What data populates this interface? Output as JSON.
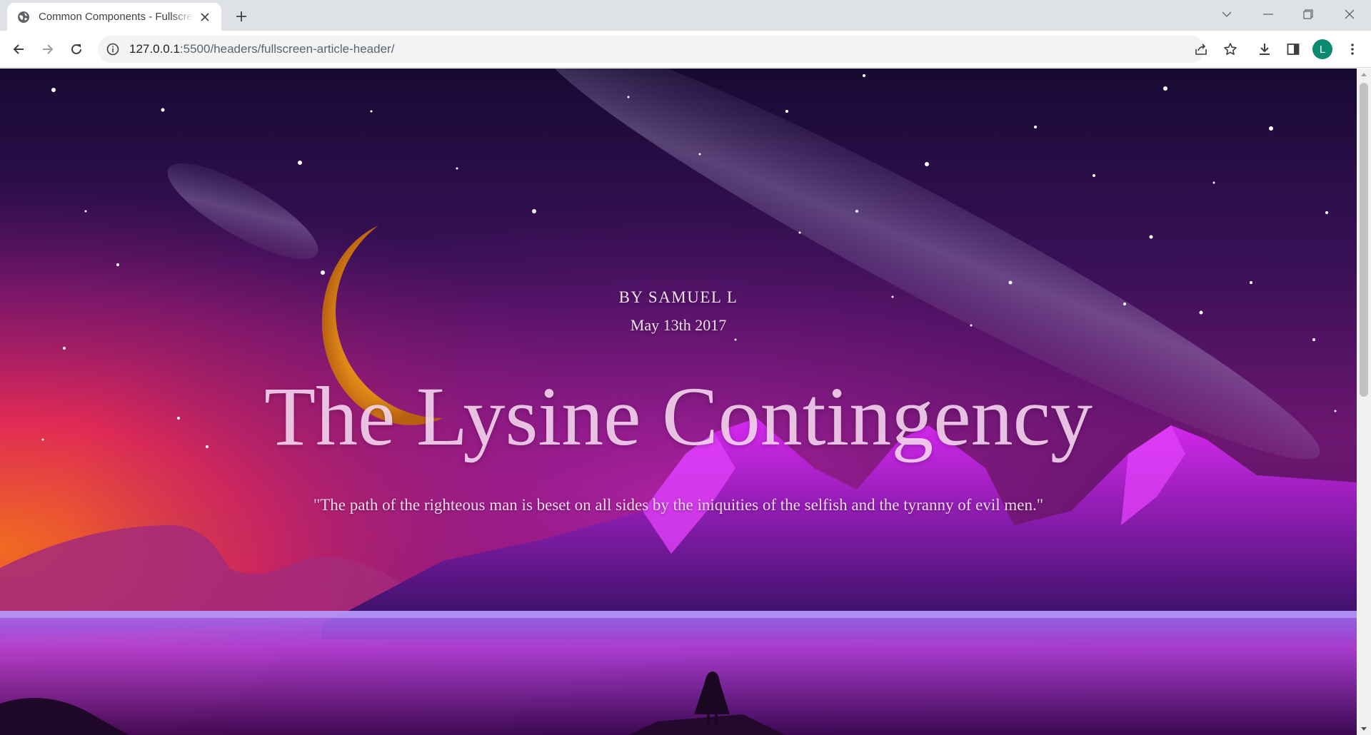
{
  "browser": {
    "tab_title": "Common Components - Fullscreen Article Header",
    "url_host": "127.0.0.1",
    "url_path": ":5500/headers/fullscreen-article-header/",
    "profile_initial": "L",
    "icons": [
      "globe-icon",
      "close-icon",
      "plus-icon",
      "chevron-down-icon",
      "minimize-icon",
      "restore-icon",
      "back-arrow-icon",
      "forward-arrow-icon",
      "reload-icon",
      "info-icon",
      "share-icon",
      "star-icon",
      "download-icon",
      "side-panel-icon",
      "kebab-menu-icon"
    ]
  },
  "article": {
    "byline": "BY SAMUEL L",
    "date": "May 13th 2017",
    "title": "The Lysine Contingency",
    "quote": "\"The path of the righteous man is beset on all sides by the iniquities of the selfish and the tyranny of evil men.\""
  },
  "colors": {
    "sky_top": "#1a0a3a",
    "sky_mid": "#5a1a7a",
    "horizon_pink": "#e8285a",
    "horizon_orange": "#f07a2a",
    "mountain_magenta": "#c020e0",
    "moon": "#f0a020",
    "avatar": "#0b8a6f"
  }
}
